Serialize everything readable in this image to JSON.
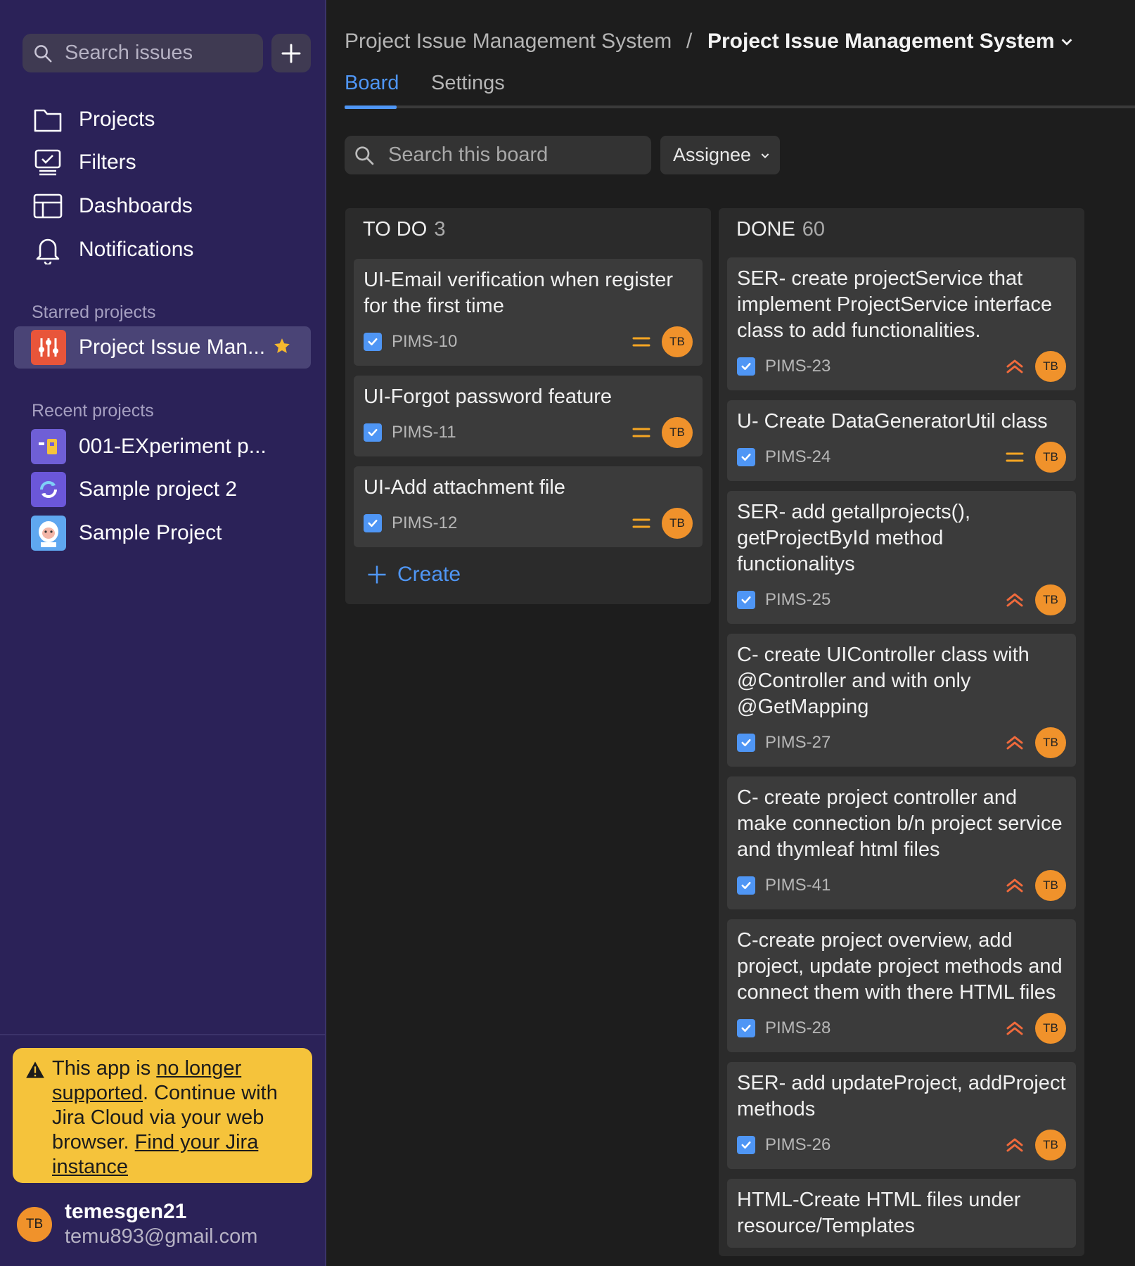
{
  "sidebar": {
    "search_placeholder": "Search issues",
    "nav": [
      {
        "label": "Projects",
        "icon": "folder-icon"
      },
      {
        "label": "Filters",
        "icon": "filter-monitor-icon"
      },
      {
        "label": "Dashboards",
        "icon": "dashboard-icon"
      },
      {
        "label": "Notifications",
        "icon": "bell-icon"
      }
    ],
    "starred_heading": "Starred projects",
    "starred": {
      "label": "Project Issue Man...",
      "icon": "project-sliders-icon"
    },
    "recent_heading": "Recent projects",
    "recent": [
      {
        "label": "001-EXperiment p...",
        "icon": "experiment-project-icon"
      },
      {
        "label": "Sample project 2",
        "icon": "sync-project-icon"
      },
      {
        "label": "Sample Project",
        "icon": "yeti-project-icon"
      }
    ],
    "banner": {
      "text1": "This app is ",
      "link1": "no longer supported",
      "text2": ". Continue with Jira Cloud via your web browser. ",
      "link2": "Find your Jira instance"
    },
    "user": {
      "initials": "TB",
      "name": "temesgen21",
      "email": "temu893@gmail.com"
    }
  },
  "header": {
    "breadcrumb_parent": "Project Issue Management System",
    "breadcrumb_separator": "/",
    "breadcrumb_current": "Project Issue Management System",
    "tabs": [
      "Board",
      "Settings"
    ],
    "active_tab": "Board"
  },
  "toolbar": {
    "search_placeholder": "Search this board",
    "assignee_label": "Assignee"
  },
  "columns": {
    "todo": {
      "title": "TO DO",
      "count": "3",
      "create_label": "Create",
      "cards": [
        {
          "title": "UI-Email verification when register for the first time",
          "key": "PIMS-10",
          "priority": "medium",
          "assignee": "TB"
        },
        {
          "title": "UI-Forgot password feature",
          "key": "PIMS-11",
          "priority": "medium",
          "assignee": "TB"
        },
        {
          "title": "UI-Add attachment file",
          "key": "PIMS-12",
          "priority": "medium",
          "assignee": "TB"
        }
      ]
    },
    "done": {
      "title": "DONE",
      "count": "60",
      "cards": [
        {
          "title": "SER- create projectService that implement ProjectService interface class to add functionalities.",
          "key": "PIMS-23",
          "priority": "high",
          "assignee": "TB"
        },
        {
          "title": "U- Create DataGeneratorUtil class",
          "key": "PIMS-24",
          "priority": "medium",
          "assignee": "TB"
        },
        {
          "title": "SER- add  getallprojects(), getProjectById method functionalitys",
          "key": "PIMS-25",
          "priority": "high",
          "assignee": "TB"
        },
        {
          "title": "C- create UIController class with @Controller and with only @GetMapping",
          "key": "PIMS-27",
          "priority": "high",
          "assignee": "TB"
        },
        {
          "title": "C- create project controller and make connection b/n project service and thymleaf html files",
          "key": "PIMS-41",
          "priority": "high",
          "assignee": "TB"
        },
        {
          "title": "C-create project overview, add project, update project methods and connect them with there HTML files",
          "key": "PIMS-28",
          "priority": "high",
          "assignee": "TB"
        },
        {
          "title": "SER- add updateProject, addProject methods",
          "key": "PIMS-26",
          "priority": "high",
          "assignee": "TB"
        },
        {
          "title": "HTML-Create HTML files under resource/Templates",
          "key": "",
          "priority": "",
          "assignee": ""
        }
      ]
    }
  },
  "colors": {
    "accent": "#4f96f5",
    "sidebar_bg": "#2b2258",
    "banner_bg": "#f5c33b",
    "avatar_bg": "#f0922b",
    "priority_medium": "#f5a623",
    "priority_high": "#f06a3c"
  }
}
